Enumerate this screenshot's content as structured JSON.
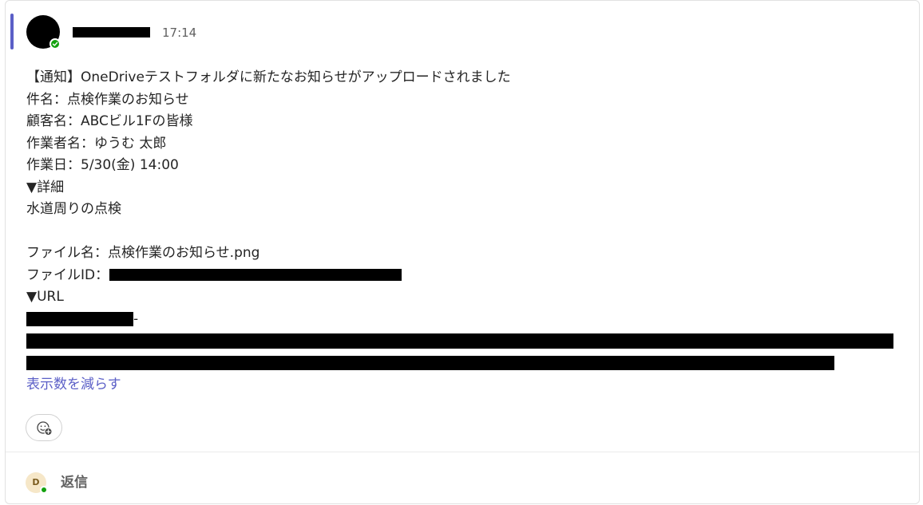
{
  "message": {
    "timestamp": "17:14",
    "lines": {
      "l1": "【通知】OneDriveテストフォルダに新たなお知らせがアップロードされました",
      "l2": "件名：点検作業のお知らせ",
      "l3": "顧客名：ABCビル1Fの皆様",
      "l4": "作業者名：ゆうむ 太郎",
      "l5": "作業日：5/30(金) 14:00",
      "l6": "▼詳細",
      "l7": "水道周りの点検",
      "l8": "ファイル名：点検作業のお知らせ.png",
      "l9_label": "ファイルID：",
      "l10": "▼URL",
      "l11_dash": "-"
    },
    "show_less_label": "表示数を減らす"
  },
  "reaction": {
    "icon": "emoji-add-icon"
  },
  "reply": {
    "avatar_initial": "D",
    "label": "返信"
  },
  "colors": {
    "accent": "#5b5fc7",
    "presence_available": "#13a10e",
    "link": "#5b5fc7",
    "redaction": "#000000"
  }
}
